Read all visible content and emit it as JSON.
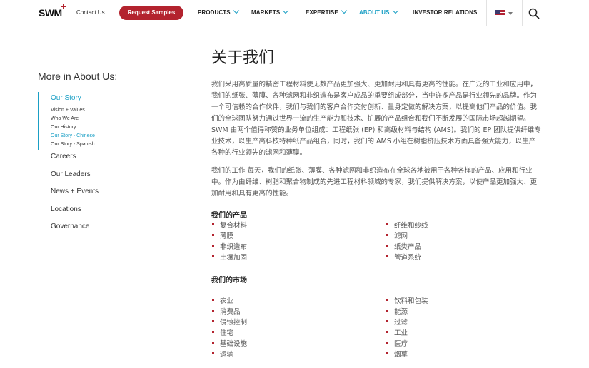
{
  "header": {
    "logo": "SWM",
    "contact": "Contact Us",
    "request": "Request Samples",
    "nav": [
      "PRODUCTS",
      "MARKETS",
      "EXPERTISE",
      "ABOUT US",
      "INVESTOR RELATIONS"
    ],
    "active_nav": "ABOUT US",
    "flag_icon": "us-flag-icon",
    "search_icon": "search-icon"
  },
  "sidebar": {
    "title": "More in About Us:",
    "our_story": "Our Story",
    "sub_items": [
      "Vision + Values",
      "Who We Are",
      "Our History",
      "Our Story - Chinese",
      "Our Story - Spanish"
    ],
    "items": [
      "Careers",
      "Our Leaders",
      "News + Events",
      "Locations",
      "Governance"
    ]
  },
  "main": {
    "title": "关于我们",
    "para1": "我们采用高质量的精密工程材料使无数产品更加强大、更加耐用和具有更高的性能。在广泛的工业和应用中，我们的纸张、薄膜、各种滤网和非织造布是客户成品的重要组成部分，当中许多产品是行业领先的品牌。作为一个可信赖的合作伙伴，我们与我们的客户合作交付创新、量身定做的解决方案，以提高他们产品的价值。我们的全球团队努力通过世界一流的生产能力和技术、扩展的产品组合和我们不断发展的国际市场超越期望。 SWM 由两个值得称赞的业务单位组成：工程纸张 (EP) 和高级材料与结构 (AMS)。我们的 EP 团队提供纤维专业技术，以生产高科技特种纸产品组合，同时，我们的 AMS 小组在树脂挤压技术方面具备强大能力，以生产各种的行业领先的滤网和薄膜。",
    "para2": "我们的工作 每天，我们的纸张、薄膜、各种滤网和非织造布在全球各地被用于各种各样的产品、应用和行业中。作为由纤维、树脂和聚合物制成的先进工程材料领域的专家，我们提供解决方案，以使产品更加强大、更加耐用和具有更高的性能。",
    "products_heading": "我们的产品",
    "products_left": [
      "复合材料",
      "薄膜",
      "非织造布",
      "土壤加固"
    ],
    "products_right": [
      "纤维和纱线",
      "滤网",
      "纸类产品",
      "管道系统"
    ],
    "markets_heading": "我们的市场",
    "markets_left": [
      "农业",
      "消费品",
      "侵蚀控制",
      "住宅",
      "基础设施",
      "运输"
    ],
    "markets_right": [
      "饮料和包装",
      "能源",
      "过滤",
      "工业",
      "医疗",
      "烟草"
    ]
  }
}
